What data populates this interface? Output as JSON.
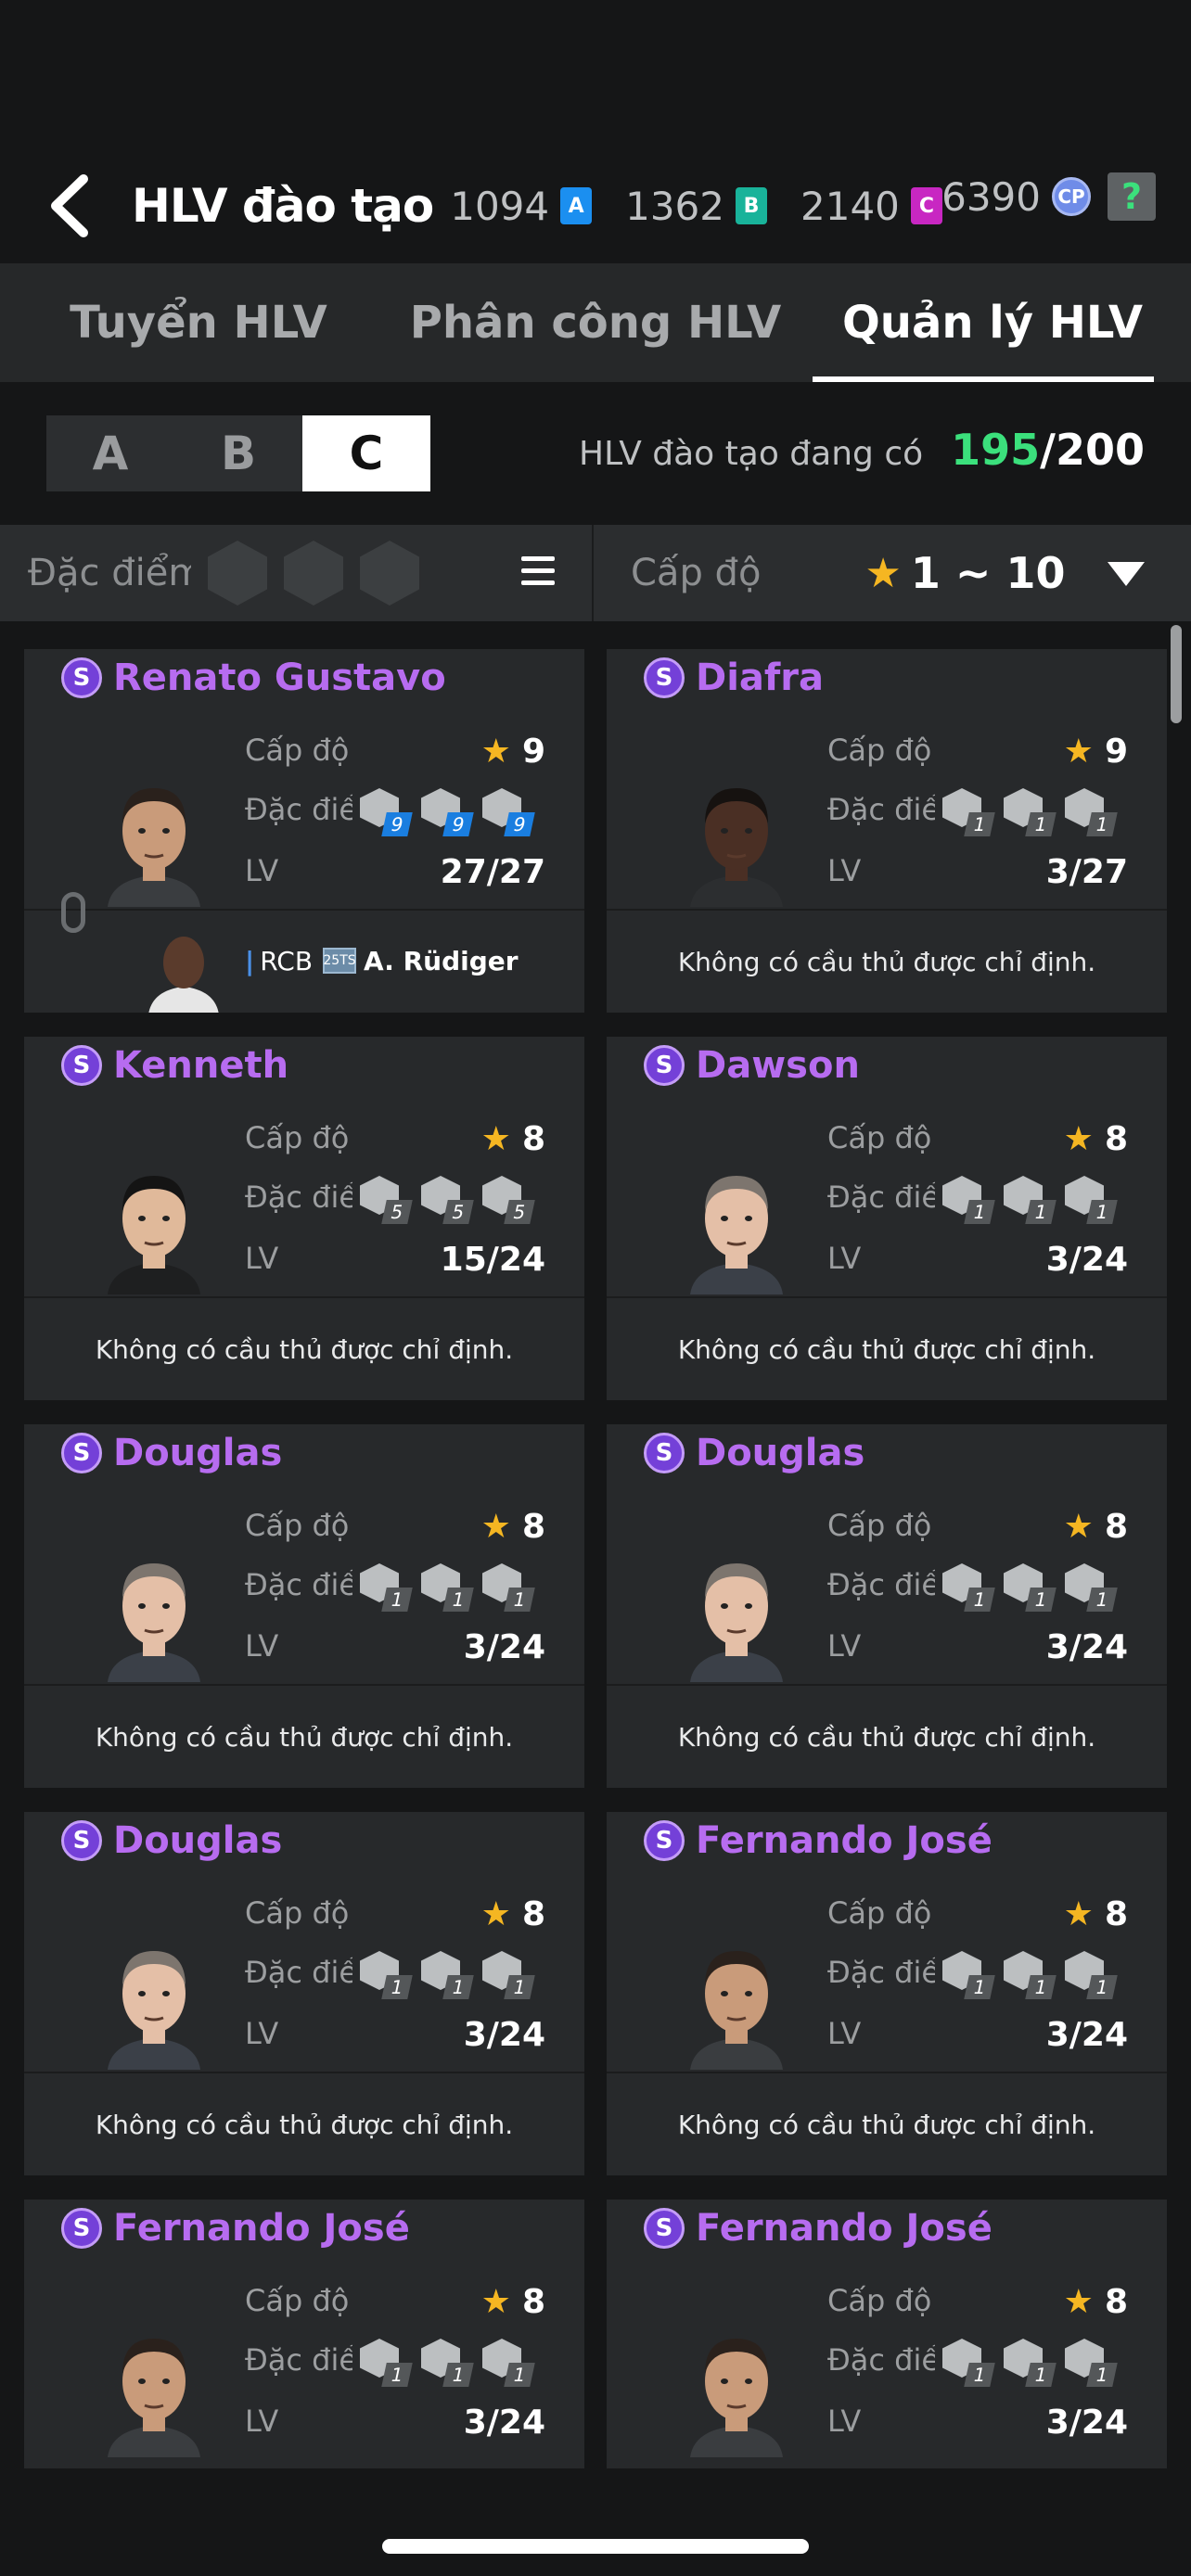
{
  "header": {
    "back_label": "",
    "title": "HLV đào tạo",
    "currencies": [
      {
        "value": "1094",
        "badge": "A",
        "color": "#1b8ff0"
      },
      {
        "value": "1362",
        "badge": "B",
        "color": "#19b39a"
      },
      {
        "value": "2140",
        "badge": "C",
        "color": "#c827c2"
      }
    ],
    "cp_value": "6390",
    "cp_badge": "CP",
    "help_badge": "?"
  },
  "tabs": [
    {
      "label": "Tuyển HLV",
      "active": false
    },
    {
      "label": "Phân công HLV",
      "active": false
    },
    {
      "label": "Quản lý HLV",
      "active": true
    }
  ],
  "grade_filter": {
    "options": [
      "A",
      "B",
      "C"
    ],
    "selected": "C"
  },
  "coach_count": {
    "label": "HLV đào tạo đang có",
    "current": "195",
    "max": "/200"
  },
  "filter_bar": {
    "trait_label": "Đặc điểm đ",
    "level_label": "Cấp độ",
    "level_range": "1 ~ 10"
  },
  "card_labels": {
    "level": "Cấp độ",
    "traits": "Đặc điểm",
    "lv": "LV",
    "rank_badge": "S"
  },
  "cards": [
    {
      "name": "Renato Gustavo",
      "level": "9",
      "lv": "27/27",
      "trait_values": [
        "9",
        "9",
        "9"
      ],
      "trait_blue": true,
      "assigned": {
        "position": "RCB",
        "season_badge": "25TS",
        "player": "A. Rüdiger"
      },
      "face": "tan"
    },
    {
      "name": "Diafra",
      "level": "9",
      "lv": "3/27",
      "trait_values": [
        "1",
        "1",
        "1"
      ],
      "trait_blue": false,
      "empty_text": "Không có cầu thủ được chỉ định.",
      "face": "dark"
    },
    {
      "name": "Kenneth",
      "level": "8",
      "lv": "15/24",
      "trait_values": [
        "5",
        "5",
        "5"
      ],
      "trait_blue": false,
      "empty_text": "Không có cầu thủ được chỉ định.",
      "face": "light"
    },
    {
      "name": "Dawson",
      "level": "8",
      "lv": "3/24",
      "trait_values": [
        "1",
        "1",
        "1"
      ],
      "trait_blue": false,
      "empty_text": "Không có cầu thủ được chỉ định.",
      "face": "pale"
    },
    {
      "name": "Douglas",
      "level": "8",
      "lv": "3/24",
      "trait_values": [
        "1",
        "1",
        "1"
      ],
      "trait_blue": false,
      "empty_text": "Không có cầu thủ được chỉ định.",
      "face": "pale"
    },
    {
      "name": "Douglas",
      "level": "8",
      "lv": "3/24",
      "trait_values": [
        "1",
        "1",
        "1"
      ],
      "trait_blue": false,
      "empty_text": "Không có cầu thủ được chỉ định.",
      "face": "pale"
    },
    {
      "name": "Douglas",
      "level": "8",
      "lv": "3/24",
      "trait_values": [
        "1",
        "1",
        "1"
      ],
      "trait_blue": false,
      "empty_text": "Không có cầu thủ được chỉ định.",
      "face": "pale"
    },
    {
      "name": "Fernando José",
      "level": "8",
      "lv": "3/24",
      "trait_values": [
        "1",
        "1",
        "1"
      ],
      "trait_blue": false,
      "empty_text": "Không có cầu thủ được chỉ định.",
      "face": "tan"
    },
    {
      "name": "Fernando José",
      "level": "8",
      "lv": "3/24",
      "trait_values": [
        "1",
        "1",
        "1"
      ],
      "trait_blue": false,
      "face": "tan"
    },
    {
      "name": "Fernando José",
      "level": "8",
      "lv": "3/24",
      "trait_values": [
        "1",
        "1",
        "1"
      ],
      "trait_blue": false,
      "face": "tan"
    }
  ],
  "colors": {
    "accent_green": "#3be07c",
    "name_purple": "#b76cf0",
    "star": "#f5b622"
  }
}
